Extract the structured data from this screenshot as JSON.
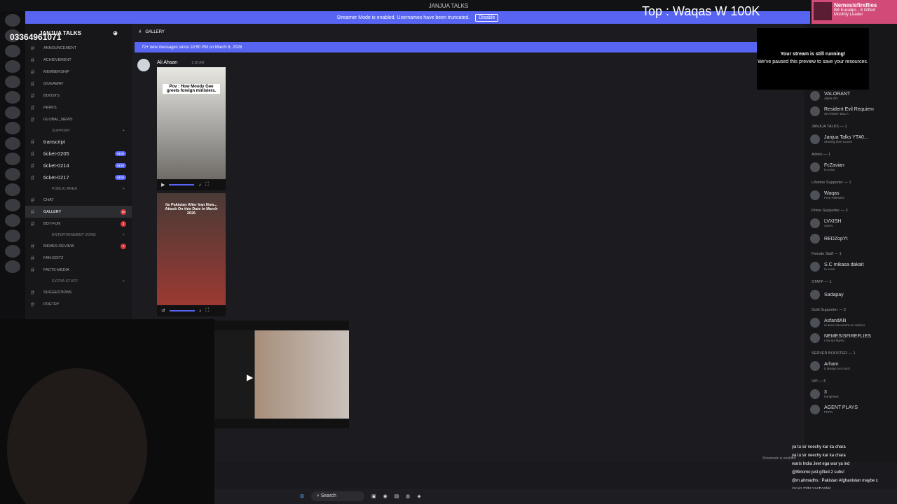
{
  "window": {
    "title": "JANJUA TALKS"
  },
  "streamer": {
    "text": "Streamer Mode is enabled. Usernames have been truncated.",
    "disable": "Disable"
  },
  "overlay": {
    "top": "Top : Waqas W 100K",
    "phone": "03364961071",
    "alert_name": "Nemesisfireflies",
    "alert_sub": "BB Eucalips - 8 Gifted",
    "alert_sub2": "Monthly Leader"
  },
  "popup": {
    "title": "Your stream is still running!",
    "body": "We've paused this preview to save your resources."
  },
  "server": {
    "name": "JANJUA TALKS"
  },
  "channels": [
    {
      "type": "ch",
      "label": "ANNOUNCEMENT"
    },
    {
      "type": "ch",
      "label": "ACHIEVEMENT"
    },
    {
      "type": "ch",
      "label": "MEMBERSHIP"
    },
    {
      "type": "ch",
      "label": "GIVEAWAY"
    },
    {
      "type": "ch",
      "label": "BOOSTS"
    },
    {
      "type": "ch",
      "label": "PERKS"
    },
    {
      "type": "ch",
      "label": "GLOBAL_NEWS"
    },
    {
      "type": "cat",
      "label": "SUPPORT"
    },
    {
      "type": "big",
      "label": "transcript"
    },
    {
      "type": "big",
      "label": "ticket-0205",
      "badge": "NEW"
    },
    {
      "type": "big",
      "label": "ticket-0214",
      "badge": "NEW"
    },
    {
      "type": "big",
      "label": "ticket-0217",
      "badge": "NEW"
    },
    {
      "type": "cat",
      "label": "PUBLIC AREA"
    },
    {
      "type": "ch",
      "label": "CHAT"
    },
    {
      "type": "ch",
      "label": "GALLERY",
      "active": true,
      "red": "10"
    },
    {
      "type": "ch",
      "label": "BOT-FUN",
      "red": "3"
    },
    {
      "type": "cat",
      "label": "ENTERTAINMENT ZONE"
    },
    {
      "type": "ch",
      "label": "MEMES-REVIEW",
      "red": "1"
    },
    {
      "type": "ch",
      "label": "FAN-EDITZ"
    },
    {
      "type": "ch",
      "label": "FACTS-MEDIA"
    },
    {
      "type": "cat",
      "label": "EXTRA STUFF"
    },
    {
      "type": "ch",
      "label": "SUGGESTIONS"
    },
    {
      "type": "ch",
      "label": "POETRY"
    }
  ],
  "chat": {
    "channel": "GALLERY",
    "new_messages": "72+ new messages since 10:50 PM on March 6, 2026",
    "author": "Ali Ahsan",
    "time": "1:38 AM",
    "caption1": "Pov : How Moody Gee greets foreign ministers.",
    "caption2": "Its Pakistan After Iran Now... Attack On this Date In March 2026",
    "slowmode": "Slowmode is enabled"
  },
  "members": [
    {
      "group": "",
      "name": "VALORANT",
      "status": "Alpha Gfx"
    },
    {
      "group": "",
      "name": "Resident Evil Requiem",
      "status": "SHAREEF BILLA"
    },
    {
      "group": "JANJUA TALKS — 1",
      "name": "Janjua Talks YT#0...",
      "status": "Sharing their screen"
    },
    {
      "group": "Admin — 1",
      "name": "FcZavian",
      "status": "In voice"
    },
    {
      "group": "Lifetime Supporter — 1",
      "name": "Waqas",
      "status": "Free Palestine"
    },
    {
      "group": "Prime Supporter — 2",
      "name": "LVXISH",
      "status": "AURA"
    },
    {
      "group": "",
      "name": "REDZopYt",
      "status": ""
    },
    {
      "group": "Female Staff — 1",
      "name": "S.C mikasa dakait",
      "status": "In voice"
    },
    {
      "group": "STAFF — 1",
      "name": "Sadapay",
      "status": ""
    },
    {
      "group": "Gold Supporter — 2",
      "name": "AsfandAlii",
      "status": "el amor encuentra un camino"
    },
    {
      "group": "",
      "name": "NEMESISFIREFLIES",
      "status": "I AM BATMAN"
    },
    {
      "group": "SERVER BOOSTER — 1",
      "name": "Arham",
      "status": "It always too much"
    },
    {
      "group": "VIP — 5",
      "name": "3",
      "status": "Irongnews"
    },
    {
      "group": "",
      "name": "AGENT PLAYS",
      "status": "PRPK"
    }
  ],
  "chatlines": [
    "ya tu sir neechy kar ka chara",
    "ya tu sir neechy kar ka chara",
    "waris India Jeet ega war ya ind",
    "@Binomo just gifted 2 subs!",
    "@m.ahmadhs : Pakistan Afghanistan maybe c",
    "jaruja talks:reshapkis",
    "@everyone MEIN BHI ABSE UPT"
  ],
  "taskbar": {
    "search": "Search"
  }
}
